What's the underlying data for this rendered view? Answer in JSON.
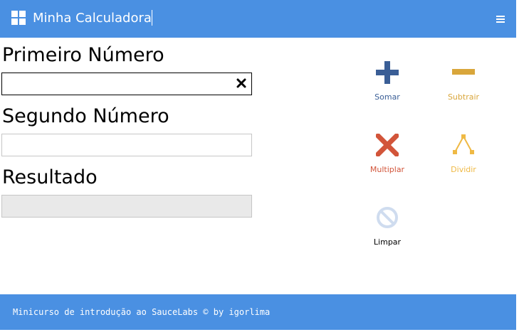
{
  "header": {
    "title": "Minha Calculadora",
    "background": "#4a90e2",
    "logo_icon": "grid-icon",
    "menu_icon": "hamburger-menu-icon"
  },
  "form": {
    "first_label": "Primeiro Número",
    "first_value": "",
    "second_label": "Segundo Número",
    "second_value": "",
    "result_label": "Resultado",
    "result_value": ""
  },
  "operations": {
    "add": {
      "label": "Somar",
      "icon": "plus-icon",
      "color": "#3a5e96"
    },
    "subtract": {
      "label": "Subtrair",
      "icon": "minus-icon",
      "color": "#d9a63b"
    },
    "multiply": {
      "label": "Multiplar",
      "icon": "times-icon",
      "color": "#d2553a"
    },
    "divide": {
      "label": "Dividir",
      "icon": "divide-icon",
      "color": "#efb944"
    },
    "clear": {
      "label": "Limpar",
      "icon": "ban-icon",
      "color": "#cfdcef"
    }
  },
  "footer": {
    "text": "Minicurso de introdução ao SauceLabs © by igorlima"
  }
}
